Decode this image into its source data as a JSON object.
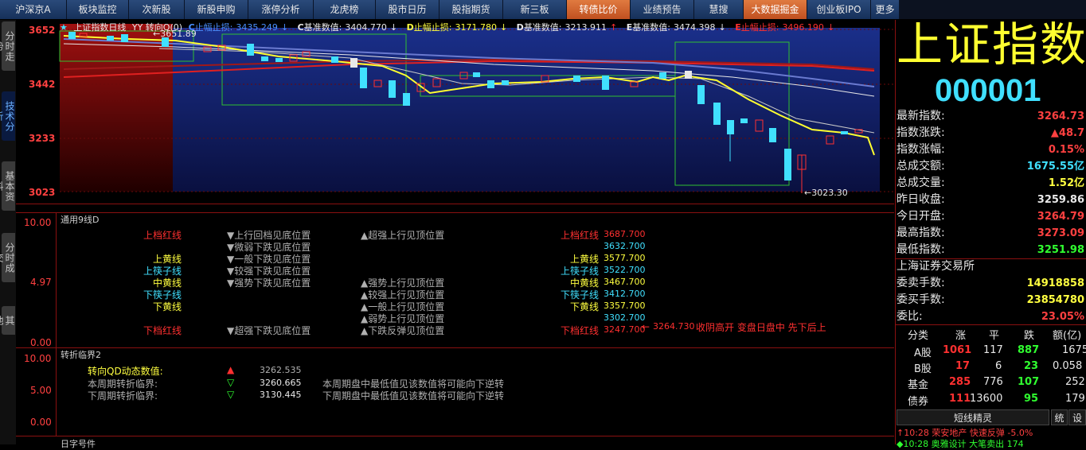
{
  "menu": [
    "沪深京A",
    "板块监控",
    "次新股",
    "新股申购",
    "涨停分析",
    "龙虎榜",
    "股市日历",
    "股指期货",
    "新三板",
    "转债比价",
    "业绩预告",
    "慧搜",
    "大数据掘金",
    "创业板IPO",
    "更多"
  ],
  "left_tabs": [
    "分时走势",
    "技术分析",
    "基本资料",
    "分时成交",
    "其他"
  ],
  "chart": {
    "title": "上证指数日线",
    "period": "YY 转向Q(0)",
    "y_labels": [
      "3652",
      "3442",
      "3233",
      "3023"
    ],
    "high_label": "3651.89",
    "low_label": "3023.30",
    "legend": [
      {
        "key": "C",
        "label": "止幅止损:",
        "value": "3435.249",
        "arrow": "↓",
        "color": "#4a90ff"
      },
      {
        "key": "C",
        "label": "基准数值:",
        "value": "3404.770",
        "arrow": "↓",
        "color": "#e8e8e8"
      },
      {
        "key": "D",
        "label": "止幅止损:",
        "value": "3171.780",
        "arrow": "↓",
        "color": "#ffff40"
      },
      {
        "key": "D",
        "label": "基准数值:",
        "value": "3213.911",
        "arrow": "↑",
        "color": "#e8e8e8"
      },
      {
        "key": "E",
        "label": "基准数值:",
        "value": "3474.398",
        "arrow": "↓",
        "color": "#e8e8e8"
      },
      {
        "key": "E",
        "label": "止幅止损:",
        "value": "3496.190",
        "arrow": "↓",
        "color": "#ff3030"
      }
    ]
  },
  "panel1": {
    "title": "通用9线D",
    "y_labels": [
      "10.00",
      "4.97",
      "0.00"
    ],
    "left_names": [
      "上档红线",
      "",
      "上黄线",
      "上筷子线",
      "中黄线",
      "下筷子线",
      "下黄线",
      "",
      "",
      "下档红线"
    ],
    "mid1": [
      "▼上行回档见底位置",
      "▼微弱下跌见底位置",
      "▼一般下跌见底位置",
      "▼较强下跌见底位置",
      "▼强势下跌见底位置",
      "",
      "",
      "",
      "",
      "▼超强下跌见底位置"
    ],
    "mid2": [
      "▲超强上行见顶位置",
      "",
      "",
      "",
      "▲强势上行见顶位置",
      "▲较强上行见顶位置",
      "▲一般上行见顶位置",
      "▲弱势上行见顶位置",
      "",
      "▲下跌反弹见顶位置"
    ],
    "right_names": [
      "上档红线",
      "",
      "上黄线",
      "上筷子线",
      "中黄线",
      "下筷子线",
      "下黄线",
      "",
      "",
      "下档红线"
    ],
    "right_values": [
      "3687.700",
      "3632.700",
      "3577.700",
      "3522.700",
      "3467.700",
      "3412.700",
      "3357.700",
      "3302.700",
      "",
      "3247.700"
    ],
    "note_value": "3264.730",
    "note_text": "收阴高开 变盘日盘中 先下后上"
  },
  "panel2": {
    "title": "转折临界2",
    "y_labels": [
      "10.00",
      "5.00",
      "0.00"
    ],
    "rows": [
      {
        "label": "转向QD动态数值:",
        "icon": "▲",
        "value": "3262.535",
        "desc": ""
      },
      {
        "label": "本周期转折临界:",
        "icon": "▽",
        "value": "3260.665",
        "desc": "本周期盘中最低值见该数值将可能向下逆转"
      },
      {
        "label": "下周期转折临界:",
        "icon": "▽",
        "value": "3130.445",
        "desc": "下周期盘中最低值见该数值将可能向下逆转"
      }
    ],
    "footer": "日字号件"
  },
  "right": {
    "name": "上证指数",
    "code": "000001",
    "quotes": [
      {
        "label": "最新指数:",
        "value": "3264.73",
        "color": "#ff4040"
      },
      {
        "label": "指数涨跌:",
        "value": "▲48.7",
        "color": "#ff4040"
      },
      {
        "label": "指数涨幅:",
        "value": "0.15%",
        "color": "#ff4040"
      },
      {
        "label": "总成交额:",
        "value": "1675.55亿",
        "color": "#40e0ff"
      },
      {
        "label": "总成交量:",
        "value": "1.52亿",
        "color": "#ffff40"
      },
      {
        "label": "昨日收盘:",
        "value": "3259.86",
        "color": "#e8e8e8"
      },
      {
        "label": "今日开盘:",
        "value": "3264.79",
        "color": "#ff4040"
      },
      {
        "label": "最高指数:",
        "value": "3273.09",
        "color": "#ff4040"
      },
      {
        "label": "最低指数:",
        "value": "3251.98",
        "color": "#30ff30"
      }
    ],
    "exchange": "上海证券交易所",
    "orders": [
      {
        "label": "委卖手数:",
        "value": "14918858",
        "color": "#ffff40"
      },
      {
        "label": "委买手数:",
        "value": "23854780",
        "color": "#ffff40"
      },
      {
        "label": "委比:",
        "value": "23.05%",
        "color": "#ff4040"
      }
    ],
    "table_header": [
      "分类",
      "涨",
      "平",
      "跌",
      "额(亿)"
    ],
    "table_rows": [
      [
        "A股",
        "1061",
        "117",
        "887",
        "1675"
      ],
      [
        "B股",
        "17",
        "6",
        "23",
        "0.058"
      ],
      [
        "基金",
        "285",
        "776",
        "107",
        "252"
      ],
      [
        "债券",
        "111",
        "13600",
        "95",
        "179"
      ]
    ],
    "buttons": [
      "短线精灵",
      "统",
      "设"
    ],
    "news": [
      {
        "time": "10:28",
        "name": "荣安地产",
        "event": "快速反弹",
        "value": "-5.0%"
      },
      {
        "time": "10:28",
        "name": "奥雅设计",
        "event": "大笔卖出",
        "value": "174"
      }
    ]
  }
}
